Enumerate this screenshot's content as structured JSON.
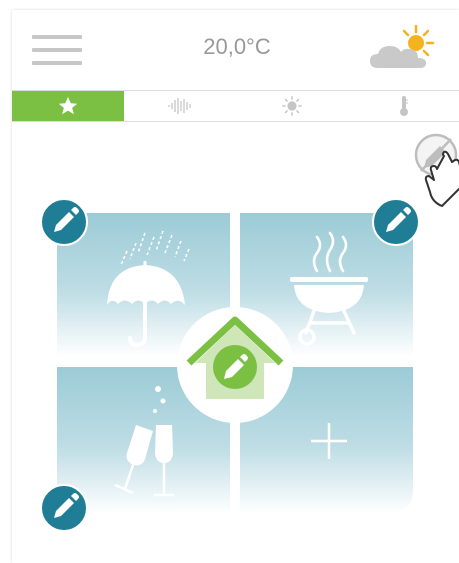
{
  "header": {
    "menu_icon": "hamburger-menu-icon",
    "temperature": "20,0°C",
    "weather_icon": "partly-cloudy-icon"
  },
  "tabs": [
    {
      "icon": "star-icon",
      "active": true
    },
    {
      "icon": "sound-wave-icon",
      "active": false
    },
    {
      "icon": "sun-brightness-icon",
      "active": false
    },
    {
      "icon": "thermometer-icon",
      "active": false
    }
  ],
  "scenes": [
    {
      "icon": "umbrella-rain-icon"
    },
    {
      "icon": "barbecue-grill-icon"
    },
    {
      "icon": "champagne-glasses-icon"
    },
    {
      "icon": "add-plus-icon"
    }
  ],
  "colors": {
    "accent_green": "#7cc043",
    "edit_teal": "#1f7e95",
    "tile_blue": "#9bcbd6",
    "text_gray": "#999999"
  }
}
